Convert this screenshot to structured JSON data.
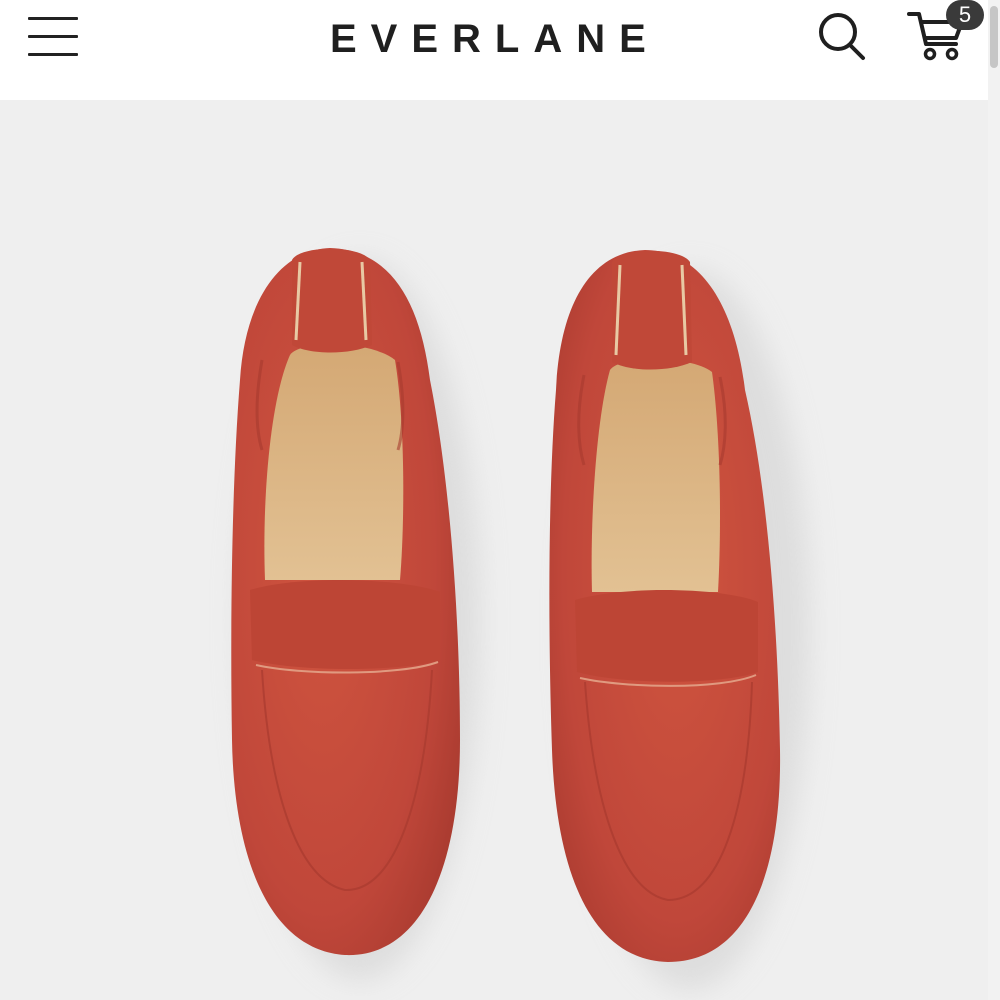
{
  "header": {
    "brand": "EVERLANE",
    "cart_count": "5"
  },
  "icons": {
    "menu": "hamburger-menu-icon",
    "search": "search-icon",
    "cart": "shopping-cart-icon"
  },
  "colors": {
    "brand_text": "#1f1f1f",
    "badge_bg": "#3a3a3a",
    "product_bg": "#efefef",
    "leather": "#c24a38",
    "lining": "#d9b184"
  }
}
